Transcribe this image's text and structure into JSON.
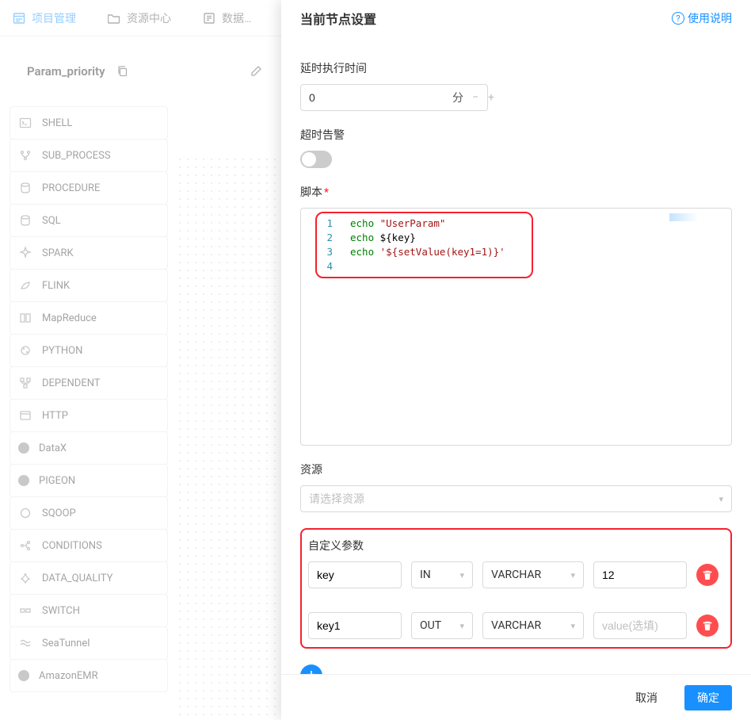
{
  "topnav": {
    "project": "项目管理",
    "resource": "资源中心",
    "dataq": "数据质量"
  },
  "project_name": "Param_priority",
  "task_types": [
    "SHELL",
    "SUB_PROCESS",
    "PROCEDURE",
    "SQL",
    "SPARK",
    "FLINK",
    "MapReduce",
    "PYTHON",
    "DEPENDENT",
    "HTTP",
    "DataX",
    "PIGEON",
    "SQOOP",
    "CONDITIONS",
    "DATA_QUALITY",
    "SWITCH",
    "SeaTunnel",
    "AmazonEMR"
  ],
  "drawer": {
    "title": "当前节点设置",
    "help": "使用说明",
    "delay_label": "延时执行时间",
    "delay_value": "0",
    "delay_unit": "分",
    "timeout_label": "超时告警",
    "script_label": "脚本",
    "script_lines": [
      {
        "ln": "1",
        "kw": "echo",
        "rest": " \"UserParam\"",
        "rest_class": "tok-str"
      },
      {
        "ln": "2",
        "kw": "echo",
        "rest": " ${key}",
        "rest_class": "tok-txt"
      },
      {
        "ln": "3",
        "kw": "echo",
        "rest": " '${setValue(key1=1)}'",
        "rest_class": "tok-str"
      },
      {
        "ln": "4",
        "kw": "",
        "rest": "",
        "rest_class": ""
      }
    ],
    "resource_label": "资源",
    "resource_placeholder": "请选择资源",
    "params_label": "自定义参数",
    "params": [
      {
        "name": "key",
        "dir": "IN",
        "type": "VARCHAR",
        "value": "12"
      },
      {
        "name": "key1",
        "dir": "OUT",
        "type": "VARCHAR",
        "value": ""
      }
    ],
    "value_placeholder": "value(选填)",
    "cancel": "取消",
    "ok": "确定"
  }
}
